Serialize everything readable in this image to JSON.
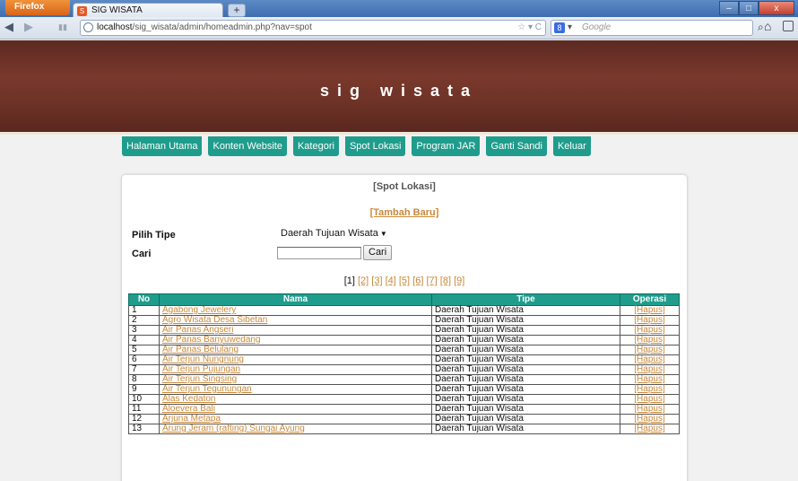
{
  "browser": {
    "app_button": "Firefox",
    "tab_title": "SIG WISATA",
    "url_host": "localhost",
    "url_path": "/sig_wisata/admin/homeadmin.php?nav=spot",
    "search_placeholder": "Google"
  },
  "site": {
    "title": "sig wisata",
    "menu": [
      "Halaman Utama",
      "Konten Website",
      "Kategori",
      "Spot Lokasi",
      "Program JAR",
      "Ganti Sandi",
      "Keluar"
    ]
  },
  "panel": {
    "title": "[Spot Lokasi]",
    "add_link": "[Tambah Baru]",
    "type_label": "Pilih Tipe",
    "type_selected": "Daerah Tujuan Wisata",
    "search_label": "Cari",
    "search_button": "Cari",
    "current_page": "[1]",
    "pages": [
      "[2]",
      "[3]",
      "[4]",
      "[5]",
      "[6]",
      "[7]",
      "[8]",
      "[9]"
    ]
  },
  "table": {
    "headers": [
      "No",
      "Nama",
      "Tipe",
      "Operasi"
    ],
    "rows": [
      {
        "no": "1",
        "nama": "Agabong Jewelery",
        "tipe": "Daerah Tujuan Wisata",
        "op": "[Hapus]"
      },
      {
        "no": "2",
        "nama": "Agro Wisata Desa Sibetan",
        "tipe": "Daerah Tujuan Wisata",
        "op": "[Hapus]"
      },
      {
        "no": "3",
        "nama": "Air Panas Angseri",
        "tipe": "Daerah Tujuan Wisata",
        "op": "[Hapus]"
      },
      {
        "no": "4",
        "nama": "Air Panas Banyuwedang",
        "tipe": "Daerah Tujuan Wisata",
        "op": "[Hapus]"
      },
      {
        "no": "5",
        "nama": "Air Panas Belulang",
        "tipe": "Daerah Tujuan Wisata",
        "op": "[Hapus]"
      },
      {
        "no": "6",
        "nama": "Air Terjun Nungnung",
        "tipe": "Daerah Tujuan Wisata",
        "op": "[Hapus]"
      },
      {
        "no": "7",
        "nama": "Air Terjun Pujungan",
        "tipe": "Daerah Tujuan Wisata",
        "op": "[Hapus]"
      },
      {
        "no": "8",
        "nama": "Air Terjun Singsing",
        "tipe": "Daerah Tujuan Wisata",
        "op": "[Hapus]"
      },
      {
        "no": "9",
        "nama": "Air Terjun Tegunungan",
        "tipe": "Daerah Tujuan Wisata",
        "op": "[Hapus]"
      },
      {
        "no": "10",
        "nama": "Alas Kedaton",
        "tipe": "Daerah Tujuan Wisata",
        "op": "[Hapus]"
      },
      {
        "no": "11",
        "nama": "Aloevera Bali",
        "tipe": "Daerah Tujuan Wisata",
        "op": "[Hapus]"
      },
      {
        "no": "12",
        "nama": "Arjuna Metapa",
        "tipe": "Daerah Tujuan Wisata",
        "op": "[Hapus]"
      },
      {
        "no": "13",
        "nama": "Arung Jeram (rafting) Sungai Ayung",
        "tipe": "Daerah Tujuan Wisata",
        "op": "[Hapus]"
      }
    ]
  },
  "colors": {
    "header_brown": "#6d3226",
    "menu_teal": "#1f9c8c",
    "link_orange": "#c8893a"
  }
}
